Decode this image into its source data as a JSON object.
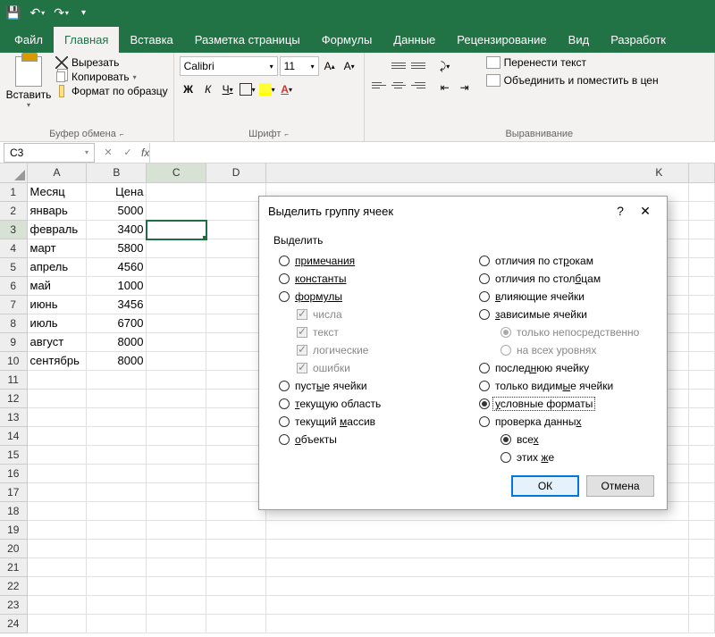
{
  "tabs": {
    "file": "Файл",
    "home": "Главная",
    "insert": "Вставка",
    "layout": "Разметка страницы",
    "formulas": "Формулы",
    "data": "Данные",
    "review": "Рецензирование",
    "view": "Вид",
    "dev": "Разработк"
  },
  "ribbon": {
    "paste": "Вставить",
    "cut": "Вырезать",
    "copy": "Копировать",
    "painter": "Формат по образцу",
    "clip_label": "Буфер обмена",
    "font_name": "Calibri",
    "font_size": "11",
    "bold": "Ж",
    "italic": "К",
    "under": "Ч",
    "font_label": "Шрифт",
    "wrap": "Перенести текст",
    "merge": "Объединить и поместить в цен",
    "align_label": "Выравнивание"
  },
  "namebox": "C3",
  "fx": "fx",
  "columns": [
    "A",
    "B",
    "C",
    "D",
    "",
    "",
    "",
    "",
    "",
    "K",
    ""
  ],
  "rows": {
    "r1": {
      "A": "Месяц",
      "B": "Цена"
    },
    "r2": {
      "A": "январь",
      "B": "5000"
    },
    "r3": {
      "A": "февраль",
      "B": "3400"
    },
    "r4": {
      "A": "март",
      "B": "5800"
    },
    "r5": {
      "A": "апрель",
      "B": "4560"
    },
    "r6": {
      "A": "май",
      "B": "1000"
    },
    "r7": {
      "A": "июнь",
      "B": "3456"
    },
    "r8": {
      "A": "июль",
      "B": "6700"
    },
    "r9": {
      "A": "август",
      "B": "8000"
    },
    "r10": {
      "A": "сентябрь",
      "B": "8000"
    }
  },
  "dialog": {
    "title": "Выделить группу ячеек",
    "section": "Выделить",
    "left": {
      "notes": "примечания",
      "const": "константы",
      "formulas": "формулы",
      "numbers": "числа",
      "text": "текст",
      "logical": "логические",
      "errors": "ошибки",
      "blanks": "пустые ячейки",
      "region": "текущую область",
      "array": "текущий массив",
      "objects": "объекты"
    },
    "right": {
      "rowdiff": "отличия по строкам",
      "coldiff": "отличия по столбцам",
      "precedents": "влияющие ячейки",
      "dependents": "зависимые ячейки",
      "direct": "только непосредственно",
      "all_levels": "на всех уровнях",
      "last": "последнюю ячейку",
      "visible": "только видимые ячейки",
      "condfmt": "условные форматы",
      "validation": "проверка данных",
      "all": "всех",
      "same": "этих же"
    },
    "ok": "ОК",
    "cancel": "Отмена"
  }
}
